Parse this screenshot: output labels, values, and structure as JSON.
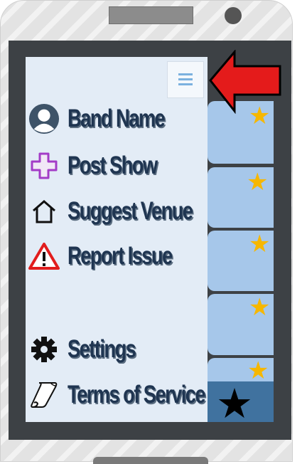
{
  "menu": {
    "items": [
      {
        "label": "Band Name",
        "icon": "user-avatar-icon"
      },
      {
        "label": "Post Show",
        "icon": "plus-icon"
      },
      {
        "label": "Suggest Venue",
        "icon": "house-icon"
      },
      {
        "label": "Report Issue",
        "icon": "warning-icon"
      },
      {
        "label": "Settings",
        "icon": "gear-icon"
      },
      {
        "label": "Terms of Service",
        "icon": "scroll-icon"
      }
    ],
    "toggle_icon": "hamburger-menu-icon"
  },
  "list": {
    "star_glyph": "★",
    "cards": 6
  },
  "colors": {
    "screen_bg": "#e3ecf6",
    "card_bg": "#a6c7ea",
    "card_active_bg": "#40729f",
    "star": "#f6b700",
    "label_text": "#1f3551",
    "arrow": "#e41b1b"
  }
}
